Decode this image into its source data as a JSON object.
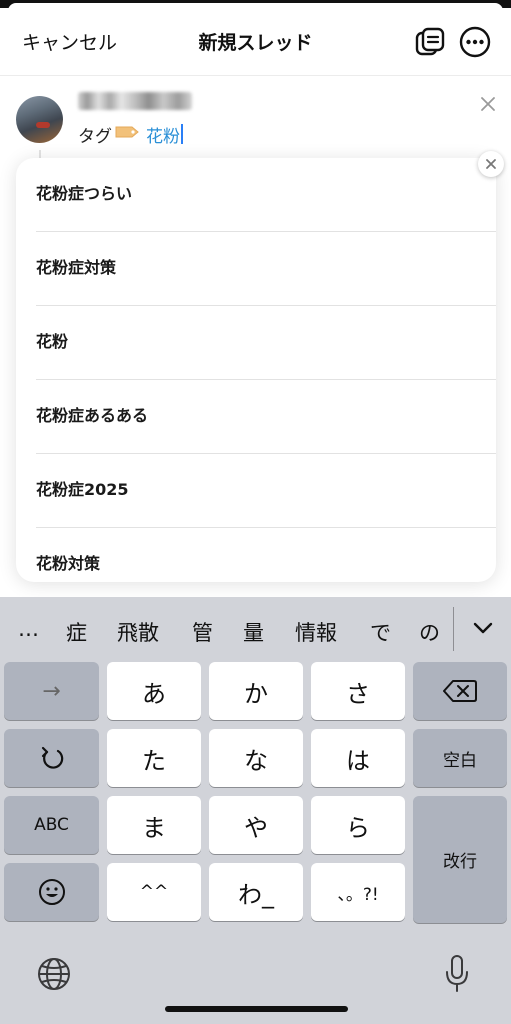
{
  "header": {
    "cancel_label": "キャンセル",
    "title": "新規スレッド",
    "drafts_icon": "drafts-icon",
    "more_icon": "more-icon"
  },
  "composer": {
    "tag_word": "タグ",
    "tag_icon": "tag-icon",
    "input_value": "花粉",
    "close_icon": "close-icon"
  },
  "suggestions": {
    "items": [
      {
        "label": "花粉症つらい"
      },
      {
        "label": "花粉症対策"
      },
      {
        "label": "花粉"
      },
      {
        "label": "花粉症あるある"
      },
      {
        "label": "花粉症2025"
      },
      {
        "label": "花粉対策"
      }
    ],
    "close_icon": "close-icon"
  },
  "keyboard": {
    "candidates": [
      "…",
      "症",
      "飛散",
      "管",
      "量",
      "情報",
      "で",
      "の"
    ],
    "keys": {
      "arrow": "→",
      "a": "あ",
      "ka": "か",
      "sa": "さ",
      "ta": "た",
      "na": "な",
      "ha": "は",
      "space": "空白",
      "abc": "ABC",
      "ma": "ま",
      "ya": "や",
      "ra": "ら",
      "enter": "改行",
      "kaomoji": "^^",
      "wa": "わ_",
      "punct": "、。?!"
    },
    "icons": {
      "delete": "delete-icon",
      "undo": "undo-icon",
      "emoji": "emoji-icon",
      "globe": "globe-icon",
      "mic": "microphone-icon",
      "expand": "chevron-down-icon"
    }
  }
}
